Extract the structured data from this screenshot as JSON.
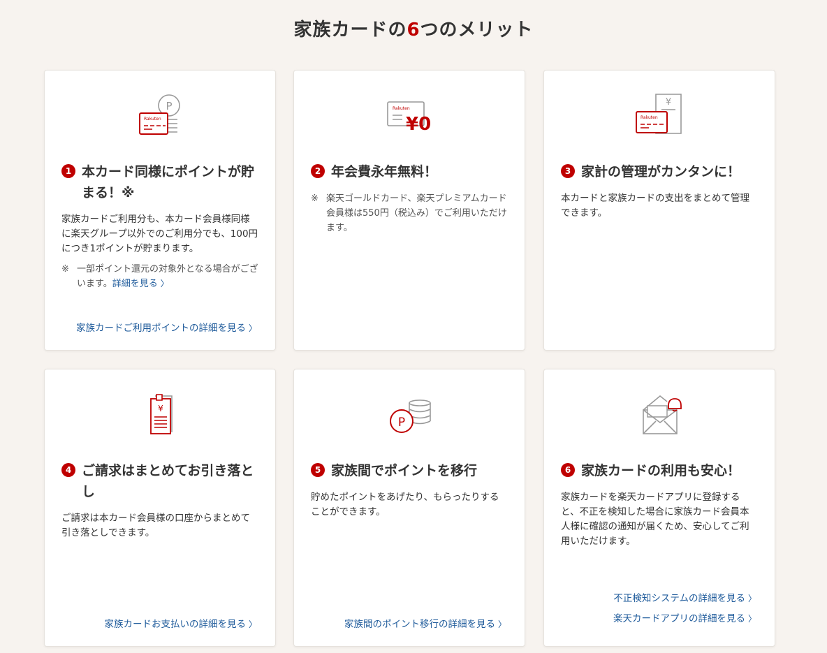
{
  "title": {
    "prefix": "家族カードの",
    "number": "6",
    "suffix": "つのメリット"
  },
  "cards": [
    {
      "num": "1",
      "heading": "本カード同様にポイントが貯まる！※",
      "body": "家族カードご利用分も、本カード会員様同様に楽天グループ以外でのご利用分でも、100円につき1ポイントが貯まります。",
      "note_mark": "※",
      "note": "一部ポイント還元の対象外となる場合がございます。",
      "note_link": "詳細を見る",
      "links": [
        "家族カードご利用ポイントの詳細を見る"
      ],
      "icon": "card-with-point-coins-icon"
    },
    {
      "num": "2",
      "heading": "年会費永年無料！",
      "note_mark": "※",
      "note": "楽天ゴールドカード、楽天プレミアムカード会員様は550円（税込み）でご利用いただけます。",
      "icon_text": "¥0",
      "icon": "card-zero-fee-icon"
    },
    {
      "num": "3",
      "heading": "家計の管理がカンタンに！",
      "body": "本カードと家族カードの支出をまとめて管理できます。",
      "icon": "card-with-receipt-icon"
    },
    {
      "num": "4",
      "heading": "ご請求はまとめてお引き落とし",
      "body": "ご請求は本カード会員様の口座からまとめて引き落としできます。",
      "links": [
        "家族カードお支払いの詳細を見る"
      ],
      "icon": "invoice-icon"
    },
    {
      "num": "5",
      "heading": "家族間でポイントを移行",
      "body": "貯めたポイントをあげたり、もらったりすることができます。",
      "links": [
        "家族間のポイント移行の詳細を見る"
      ],
      "icon": "point-transfer-icon"
    },
    {
      "num": "6",
      "heading": "家族カードの利用も安心！",
      "body": "家族カードを楽天カードアプリに登録すると、不正を検知した場合に家族カード会員本人様に確認の通知が届くため、安心してご利用いただけます。",
      "links": [
        "不正検知システムの詳細を見る",
        "楽天カードアプリの詳細を見る"
      ],
      "icon": "mail-alert-icon"
    }
  ],
  "icon_brand_text": "Rakuten",
  "icon_point_text": "P",
  "icon_yen_text": "¥",
  "chevron": "〉",
  "colors": {
    "accent": "#bf0000",
    "link": "#1f5b9b",
    "background": "#f7f3ef"
  }
}
